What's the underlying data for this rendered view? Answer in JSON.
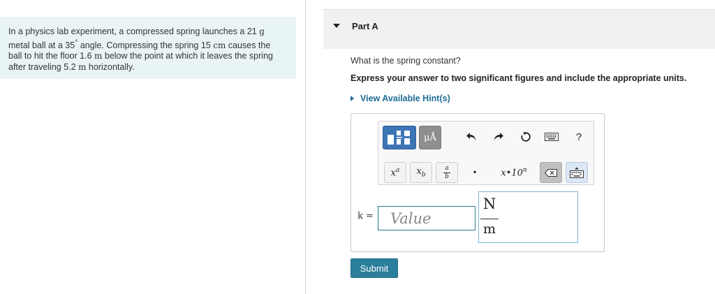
{
  "problem": {
    "line1_text": "In a physics lab experiment, a compressed spring launches a 21 ",
    "line1_unit": "g",
    "line2_a": "metal ball at a 35",
    "line2_deg": "°",
    "line2_b": " angle. Compressing the spring 15 ",
    "line2_unit": "cm",
    "line2_c": " causes the",
    "line3_a": "ball to hit the floor 1.6 ",
    "line3_unit": "m",
    "line3_b": " below the point at which it leaves the spring",
    "line4_a": "after traveling 5.2 ",
    "line4_unit": "m",
    "line4_b": " horizontally."
  },
  "part": {
    "title": "Part A"
  },
  "question": "What is the spring constant?",
  "instruction": "Express your answer to two significant figures and include the appropriate units.",
  "hint_label": "View Available Hint(s)",
  "toolbar": {
    "units_label": "μÅ",
    "key_superscript": {
      "base": "x",
      "sup": "a"
    },
    "key_subscript": {
      "base": "x",
      "sub": "b"
    },
    "key_fraction": {
      "num": "a",
      "den": "b"
    },
    "key_dot": "•",
    "key_sci": {
      "base": "x•10",
      "sup": "n"
    },
    "help": "?"
  },
  "answer": {
    "label": "k =",
    "placeholder": "Value",
    "unit_numerator": "N",
    "unit_denominator": "m"
  },
  "submit_label": "Submit"
}
